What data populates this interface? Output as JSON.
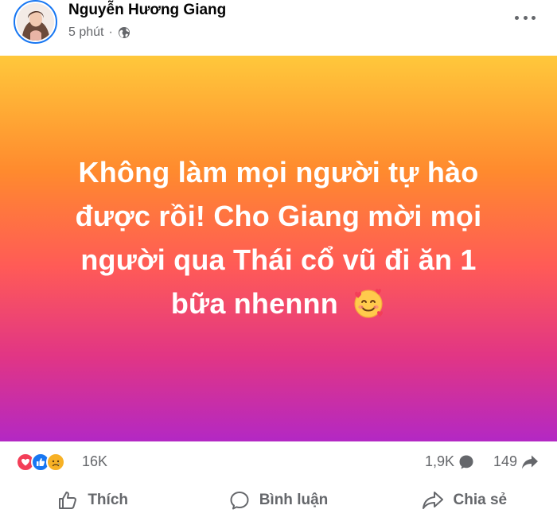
{
  "post": {
    "author": "Nguyễn Hương Giang",
    "time": "5 phút",
    "separator": "·",
    "audience_icon": "globe-icon",
    "text_lines": [
      "Không làm mọi người tự hào",
      "được rồi! Cho Giang mời mọi",
      "người qua Thái cổ vũ đi ăn 1",
      "bữa nhennn"
    ],
    "emoji": "smiling-face-with-hearts-icon",
    "gradient_colors": [
      "#ffc83b",
      "#ff8a2e",
      "#ff5a57",
      "#e13585",
      "#b328c4"
    ]
  },
  "stats": {
    "reactions": [
      "love-icon",
      "like-icon",
      "sad-icon"
    ],
    "reaction_count": "16K",
    "comment_count": "1,9K",
    "share_count": "149"
  },
  "actions": {
    "like": "Thích",
    "comment": "Bình luận",
    "share": "Chia sẻ"
  },
  "colors": {
    "accent": "#1877f2",
    "muted": "#65676b",
    "love": "#f33e58",
    "sad": "#f7b125"
  }
}
